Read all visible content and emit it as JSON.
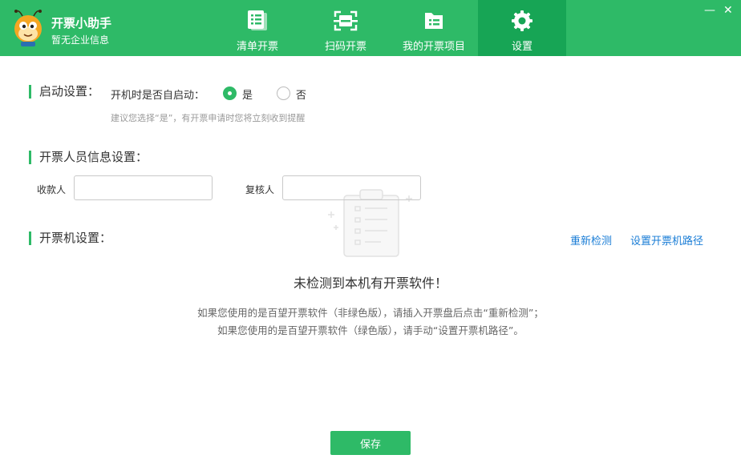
{
  "app": {
    "title": "开票小助手",
    "subtitle": "暂无企业信息"
  },
  "nav": [
    {
      "label": "清单开票",
      "icon": "list-invoice-icon"
    },
    {
      "label": "扫码开票",
      "icon": "scan-icon"
    },
    {
      "label": "我的开票项目",
      "icon": "folder-icon"
    },
    {
      "label": "设置",
      "icon": "gear-icon",
      "active": true
    }
  ],
  "startup": {
    "section_title": "启动设置：",
    "question": "开机时是否自启动：",
    "yes_label": "是",
    "no_label": "否",
    "selected": "是",
    "hint": "建议您选择“是”，有开票申请时您将立刻收到提醒"
  },
  "staff": {
    "section_title": "开票人员信息设置：",
    "payee_label": "收款人",
    "payee_value": "",
    "reviewer_label": "复核人",
    "reviewer_value": ""
  },
  "machine": {
    "section_title": "开票机设置：",
    "redetect_label": "重新检测",
    "set_path_label": "设置开票机路径",
    "empty_title": "未检测到本机有开票软件！",
    "empty_desc_1": "如果您使用的是百望开票软件（非绿色版），请插入开票盘后点击“重新检测”；",
    "empty_desc_2": "如果您使用的是百望开票软件（绿色版），请手动“设置开票机路径”。"
  },
  "save_label": "保存",
  "colors": {
    "brand": "#2eba67",
    "brand_active": "#17a555",
    "link": "#1a7dd6"
  }
}
